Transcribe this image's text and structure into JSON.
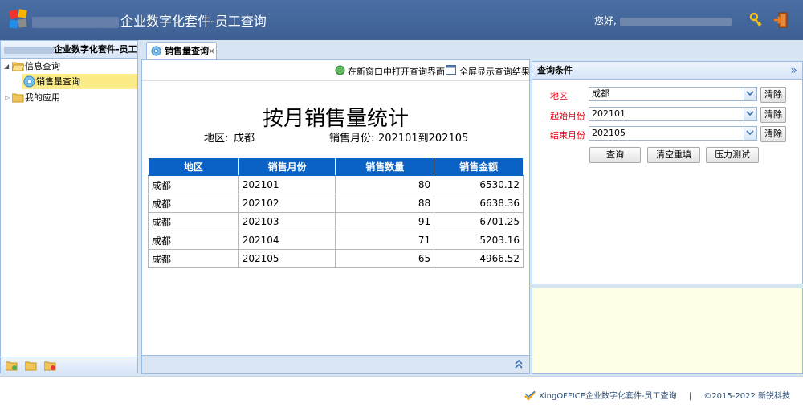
{
  "header": {
    "app_title": "企业数字化套件-员工查询",
    "greeting": "您好,"
  },
  "sidebar": {
    "title": "企业数字化套件-员工查",
    "items": [
      {
        "label": "信息查询"
      },
      {
        "label": "销售量查询"
      },
      {
        "label": "我的应用"
      }
    ]
  },
  "tab": {
    "label": "销售量查询",
    "close": "×"
  },
  "toolbar": {
    "open_new_window": "在新窗口中打开查询界面",
    "fullscreen": "全屏显示查询结果"
  },
  "report": {
    "title": "按月销售量统计",
    "region_label": "地区:",
    "region_value": "成都",
    "month_label": "销售月份:",
    "month_value": "202101到202105",
    "columns": [
      "地区",
      "销售月份",
      "销售数量",
      "销售金额"
    ],
    "rows": [
      [
        "成都",
        "202101",
        "80",
        "6530.12"
      ],
      [
        "成都",
        "202102",
        "88",
        "6638.36"
      ],
      [
        "成都",
        "202103",
        "91",
        "6701.25"
      ],
      [
        "成都",
        "202104",
        "71",
        "5203.16"
      ],
      [
        "成都",
        "202105",
        "65",
        "4966.52"
      ]
    ]
  },
  "query": {
    "title": "查询条件",
    "collapse": "»",
    "fields": [
      {
        "label": "地区",
        "value": "成都",
        "clear": "清除"
      },
      {
        "label": "起始月份",
        "value": "202101",
        "clear": "清除"
      },
      {
        "label": "结束月份",
        "value": "202105",
        "clear": "清除"
      }
    ],
    "buttons": {
      "search": "查询",
      "reset": "清空重填",
      "stress": "压力测试"
    }
  },
  "footer": {
    "product": "XingOFFICE企业数字化套件-员工查询",
    "separator": "|",
    "copyright": "©2015-2022 新锐科技"
  },
  "colors": {
    "header_bg": "#3e5f92",
    "grid_header": "#0a63c4",
    "required_label": "#e60012",
    "selected_row": "#fbec88"
  }
}
